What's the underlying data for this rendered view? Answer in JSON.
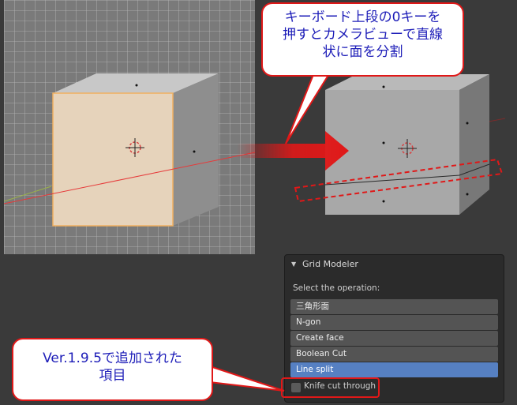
{
  "callout_top": {
    "lines": [
      "キーボード上段の0キーを",
      "押すとカメラビューで直線",
      "状に面を分割"
    ]
  },
  "callout_bottom": {
    "lines": [
      "Ver.1.9.5で追加された",
      "項目"
    ]
  },
  "panel": {
    "title": "Grid Modeler",
    "prompt": "Select the operation:",
    "operations": [
      "三角形面",
      "N-gon",
      "Create face",
      "Boolean Cut",
      "Line split"
    ],
    "selected": "Line split",
    "checkbox": {
      "label": "Knife cut through",
      "checked": false
    }
  },
  "colors": {
    "accent": "#e01818",
    "callout_text": "#1d1db8",
    "selected": "#5680c2"
  },
  "icons": [
    "disclosure-triangle-icon",
    "3d-cursor-icon",
    "arrow-right-icon"
  ]
}
